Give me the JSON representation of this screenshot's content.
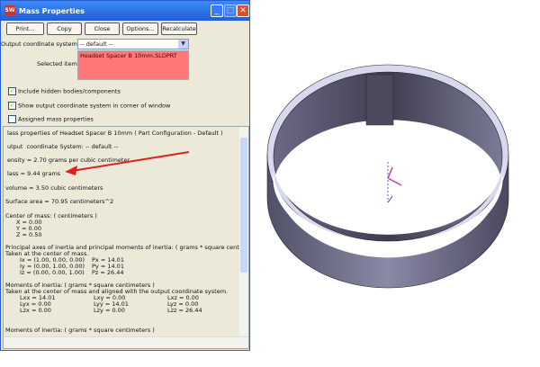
{
  "window": {
    "title": "Mass Properties",
    "app_icon": "SW"
  },
  "toolbar": {
    "print": "Print...",
    "copy": "Copy",
    "close": "Close",
    "options": "Options...",
    "recalculate": "Recalculate"
  },
  "coord": {
    "label": "Output coordinate system:",
    "value": "-- default --"
  },
  "selected": {
    "label": "Selected items:",
    "value": "Headset Spacer B 10mm.SLDPRT"
  },
  "options": {
    "hidden": "Include hidden bodies/components",
    "hidden_checked": true,
    "show_coord": "Show output coordinate system in corner of window",
    "show_checked": true,
    "assigned": "Assigned mass properties",
    "assigned_checked": false
  },
  "report": {
    "l1": "lass properties of Headset Spacer B 10mm ( Part Configuration - Default )",
    "l2": "utput  coordinate System: -- default --",
    "l3": "ensity = 2.70 grams per cubic centimeter",
    "l4": "lass = 9.44 grams",
    "l5": "volume = 3.50 cubic centimeters",
    "l6": "Surface area = 70.95 centimeters^2",
    "com": "Center of mass: ( centimeters )",
    "x": "X = 0.00",
    "y": "Y = 0.00",
    "z": "Z = 0.50",
    "pa": "Principal axes of inertia and principal moments of inertia: ( grams * square centimeters )",
    "taken": "Taken at the center of mass.",
    "ix": "Ix = (1.00, 0.00, 0.00)",
    "iy": "Iy = (0.00, 1.00, 0.00)",
    "iz": "Iz = (0.00, 0.00, 1.00)",
    "px": "Px = 14.01",
    "py": "Py = 14.01",
    "pz": "Pz = 26.44",
    "moi": "Moments of inertia: ( grams * square centimeters )",
    "taken2": "Taken at the center of mass and aligned with the output coordinate system.",
    "lxx": "Lxx = 14.01",
    "lxy": "Lxy = 0.00",
    "lxz": "Lxz = 0.00",
    "lyx": "Lyx = 0.00",
    "lyy": "Lyy = 14.01",
    "lyz": "Lyz = 0.00",
    "lzx": "Lzx = 0.00",
    "lzy": "Lzy = 0.00",
    "lzz": "Lzz = 26.44",
    "moi2": "Moments of inertia: ( grams * square centimeters )"
  },
  "colors": {
    "arrow": "#e02020",
    "selection": "#ff7777",
    "part": "#5a5870"
  }
}
